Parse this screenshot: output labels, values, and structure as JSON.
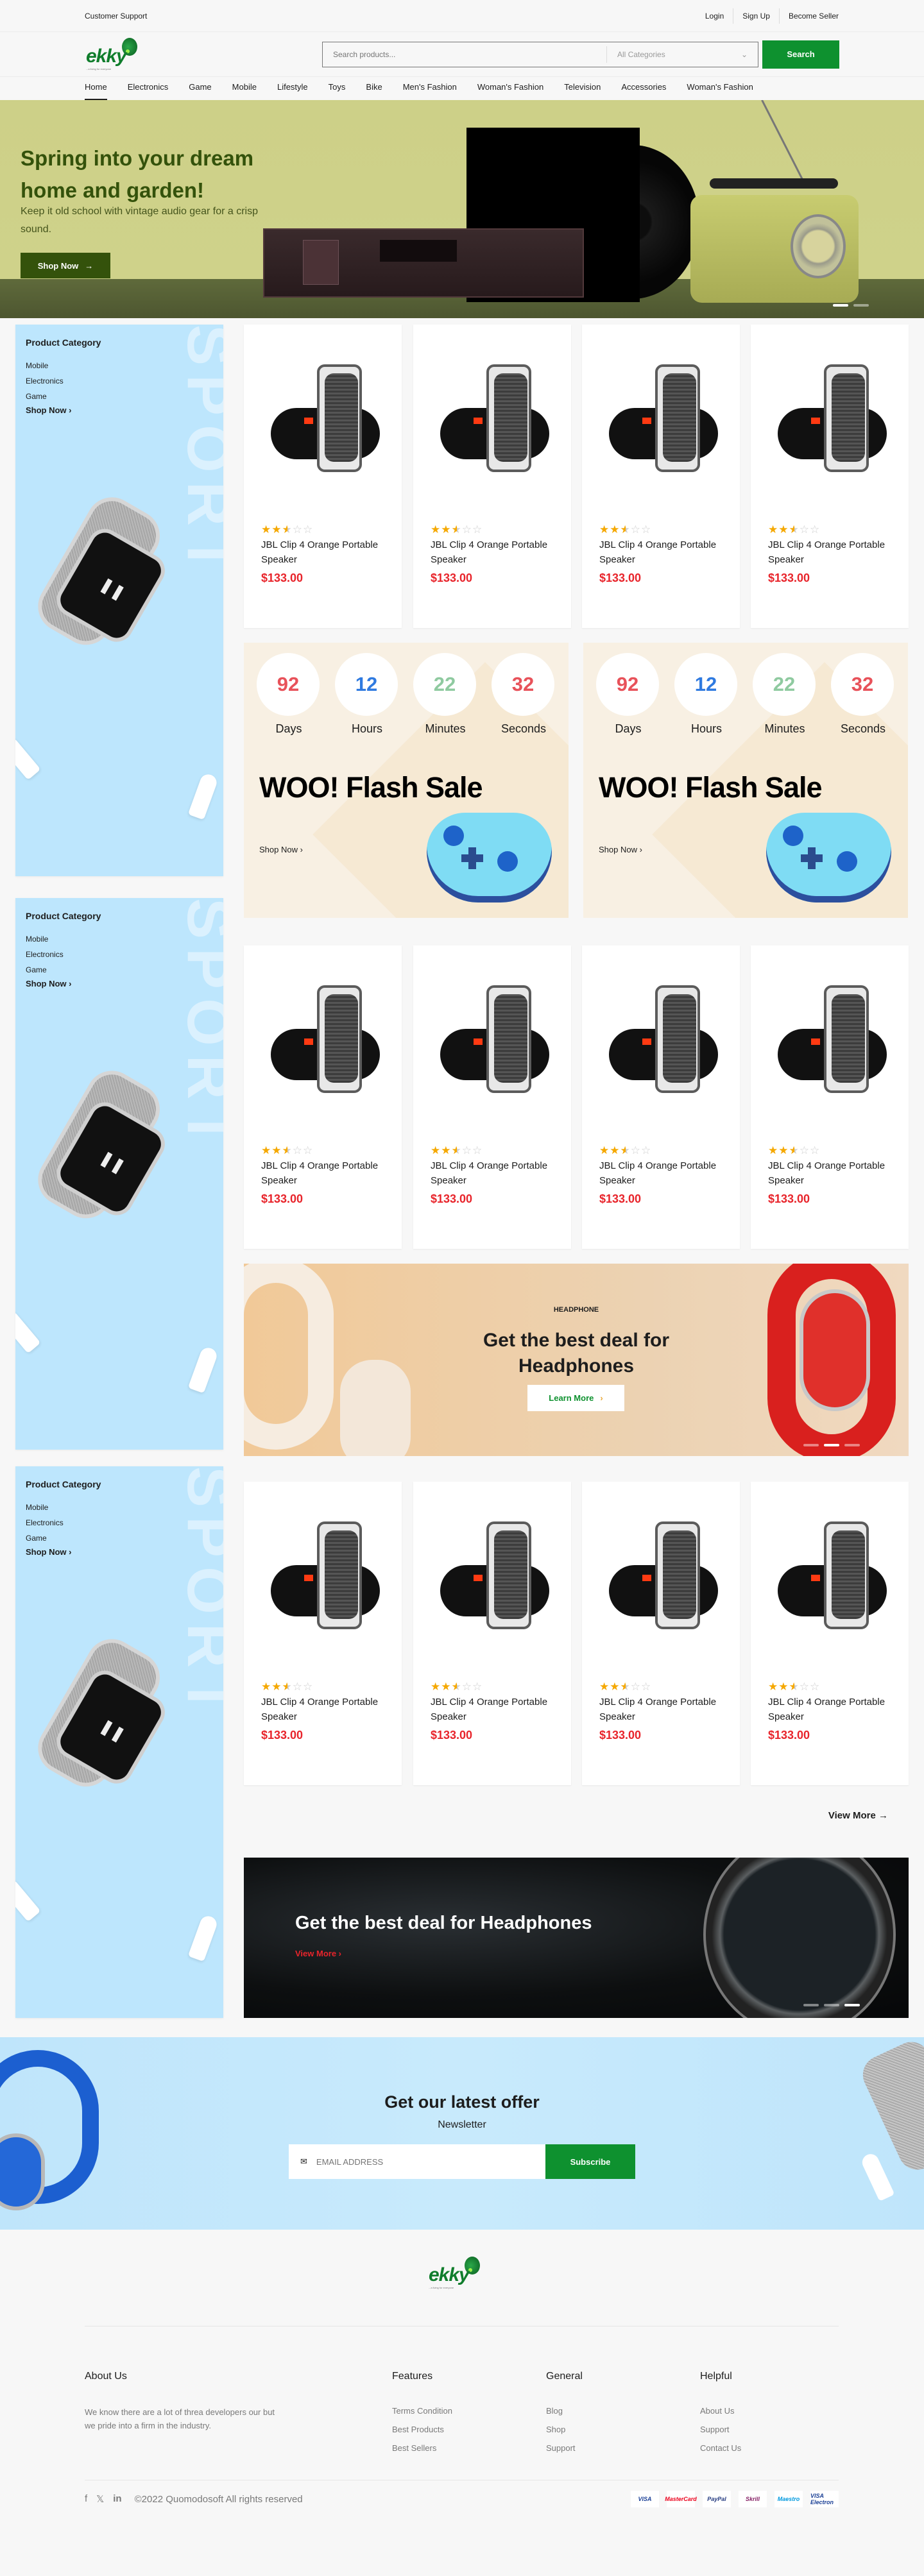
{
  "topbar": {
    "support": "Customer Support",
    "login": "Login",
    "signup": "Sign Up",
    "seller": "Become Seller"
  },
  "header": {
    "logo_text": "ekky",
    "logo_tagline": "...a living for everyone",
    "search_placeholder": "Search products...",
    "category_selected": "All Categories",
    "search_button": "Search"
  },
  "nav": [
    "Home",
    "Electronics",
    "Game",
    "Mobile",
    "Lifestyle",
    "Toys",
    "Bike",
    "Men's Fashion",
    "Woman's Fashion",
    "Television",
    "Accessories",
    "Woman's Fashion"
  ],
  "hero": {
    "title": "Spring into your dream home and garden!",
    "subtitle": "Keep it old school with vintage audio gear for a crisp sound.",
    "button": "Shop Now",
    "slides": 2,
    "active_slide": 1
  },
  "sidebar": {
    "title": "Product Category",
    "items": [
      "Mobile",
      "Electronics",
      "Game"
    ],
    "shop_now": "Shop Now",
    "watermark": "SPORT"
  },
  "product": {
    "rating": 2.5,
    "max_rating": 5,
    "name": "JBL Clip 4 Orange Portable Speaker",
    "price": "$133.00"
  },
  "flash_sale": {
    "countdown": [
      {
        "value": "92",
        "label": "Days",
        "color": "#e8525a"
      },
      {
        "value": "12",
        "label": "Hours",
        "color": "#2f7ae0"
      },
      {
        "value": "22",
        "label": "Minutes",
        "color": "#8fcaa0"
      },
      {
        "value": "32",
        "label": "Seconds",
        "color": "#e8525a"
      }
    ],
    "title": "WOO! Flash Sale",
    "link": "Shop Now"
  },
  "headphone_banner": {
    "caption": "HEADPHONE",
    "title": "Get the best deal for Headphones",
    "button": "Learn More",
    "slides": 3,
    "active_slide": 2
  },
  "view_more": "View More",
  "watch_banner": {
    "title": "Get the best deal for Headphones",
    "link": "View More",
    "slides": 3,
    "active_slide": 3
  },
  "newsletter": {
    "title": "Get our latest offer",
    "subtitle": "Newsletter",
    "placeholder": "EMAIL ADDRESS",
    "button": "Subscribe"
  },
  "footer": {
    "about": {
      "title": "About Us",
      "text": "We know there are a lot of threa developers our but we pride into a firm in the industry."
    },
    "columns": [
      {
        "title": "Features",
        "links": [
          "Terms Condition",
          "Best Products",
          "Best Sellers"
        ]
      },
      {
        "title": "General",
        "links": [
          "Blog",
          "Shop",
          "Support"
        ]
      },
      {
        "title": "Helpful",
        "links": [
          "About Us",
          "Support",
          "Contact Us"
        ]
      }
    ],
    "social": [
      "facebook-icon",
      "twitter-icon",
      "linkedin-icon"
    ],
    "copyright": "©2022 Quomodosoft All rights reserved",
    "payments": [
      "VISA",
      "MasterCard",
      "PayPal",
      "Skrill",
      "Maestro",
      "VISA Electron"
    ]
  },
  "colors": {
    "brand_green": "#0e912f",
    "price_red": "#e8242b",
    "star": "#f5a800",
    "hero_text": "#34520b"
  }
}
